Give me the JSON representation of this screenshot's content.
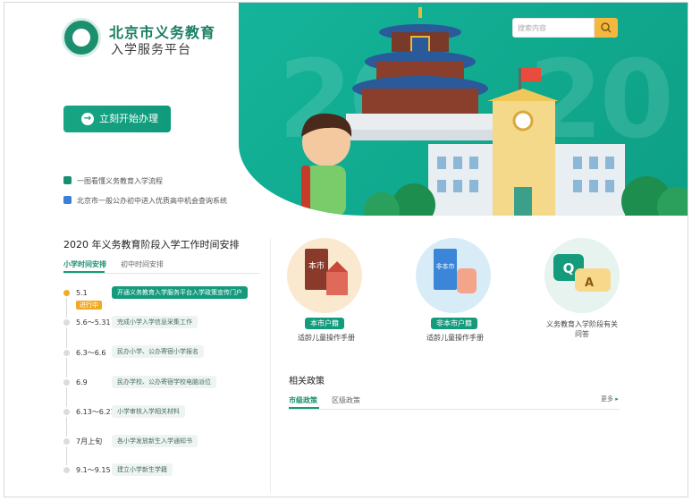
{
  "brand": {
    "title": "北京市义务教育",
    "subtitle": "入学服务平台"
  },
  "search": {
    "placeholder": "搜索内容"
  },
  "hero": {
    "year": "2020"
  },
  "actions": {
    "start_label": "立刻开始办理"
  },
  "links": [
    {
      "label": "一图看懂义务教育入学流程",
      "icon": "flowchart-icon",
      "color": "#1a8f6f"
    },
    {
      "label": "北京市一般公办初中进入优质高中机会查询系统",
      "icon": "search-doc-icon",
      "color": "#3b7fd6"
    }
  ],
  "schedule": {
    "title": "2020 年义务教育阶段入学工作时间安排",
    "tabs": [
      {
        "label": "小学时间安排"
      },
      {
        "label": "初中时间安排"
      }
    ],
    "ongoing_label": "进行中",
    "items": [
      {
        "date": "5.1",
        "text": "开通义务教育入学服务平台入学政策宣传门户"
      },
      {
        "date": "5.6～5.31",
        "text": "完成小学入学信息采集工作"
      },
      {
        "date": "6.3～6.6",
        "text": "民办小学、公办寄宿小学报名"
      },
      {
        "date": "6.9",
        "text": "民办学校、公办寄宿学校电脑派位"
      },
      {
        "date": "6.13～6.21",
        "text": "小学审核入学相关材料"
      },
      {
        "date": "7月上旬",
        "text": "各小学发放新生入学通知书"
      },
      {
        "date": "9.1～9.15",
        "text": "建立小学新生学籍"
      }
    ]
  },
  "categories": [
    {
      "badge": "本市户籍",
      "sub": "适龄儿童操作手册",
      "icon_text": "本市"
    },
    {
      "badge": "非本市户籍",
      "sub": "适龄儿童操作手册",
      "icon_text": "非本市"
    },
    {
      "badge": "",
      "sub": "义务教育入学阶段有关问答",
      "icon_text": "Q",
      "icon_text2": "A"
    }
  ],
  "policy": {
    "title": "相关政策",
    "tabs": [
      {
        "label": "市级政策"
      },
      {
        "label": "区级政策"
      }
    ],
    "more": "更多"
  },
  "colors": {
    "primary": "#149b7c",
    "accent": "#f3a925",
    "blue": "#3b86d8"
  }
}
